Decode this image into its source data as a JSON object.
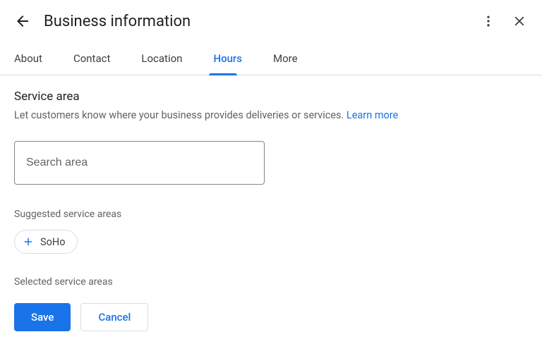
{
  "header": {
    "title": "Business information"
  },
  "tabs": {
    "about": "About",
    "contact": "Contact",
    "location": "Location",
    "hours": "Hours",
    "more": "More"
  },
  "section": {
    "title": "Service area",
    "description": "Let customers know where your business provides deliveries or services. ",
    "learn_more": "Learn more"
  },
  "search": {
    "placeholder": "Search area"
  },
  "suggested": {
    "label": "Suggested service areas",
    "chip": "SoHo"
  },
  "selected": {
    "label": "Selected service areas"
  },
  "buttons": {
    "save": "Save",
    "cancel": "Cancel"
  }
}
